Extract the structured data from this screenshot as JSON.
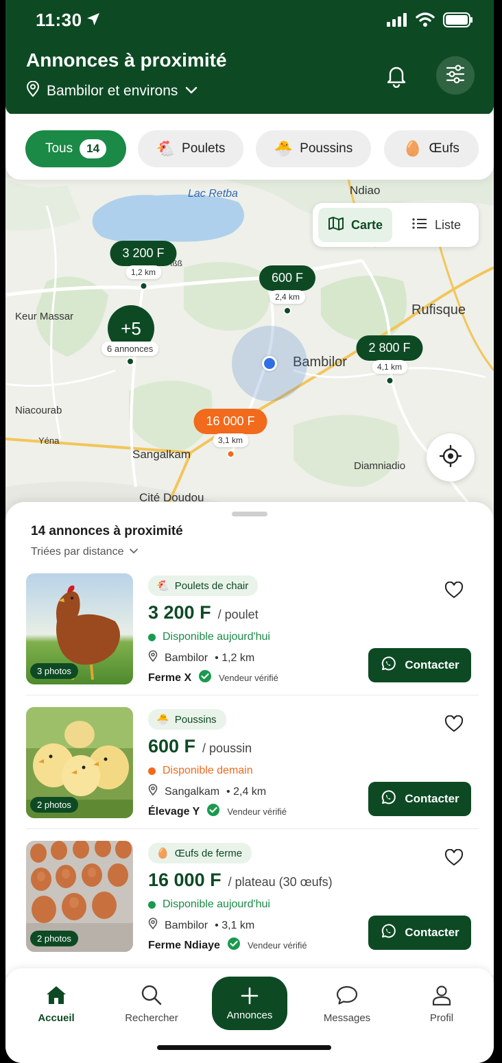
{
  "status_bar": {
    "time": "11:30"
  },
  "header": {
    "title": "Annonces à proximité",
    "location": "Bambilor et environs"
  },
  "filters": [
    {
      "label": "Tous",
      "count": "14",
      "active": true
    },
    {
      "label": "Poulets",
      "icon": "chicken-emoji"
    },
    {
      "label": "Poussins",
      "icon": "chick-emoji"
    },
    {
      "label": "Œufs",
      "icon": "egg-emoji"
    }
  ],
  "map": {
    "toggle": {
      "map_label": "Carte",
      "list_label": "Liste"
    },
    "places": [
      "Lac Retba",
      "Ndiao",
      "Keur Massar",
      "Rufisque",
      "Bambilor",
      "Niacourab",
      "Yéna",
      "Sangalkam",
      "Diamniadio",
      "Cité Doudou",
      "ıßß"
    ],
    "pins": [
      {
        "price": "3 200 F",
        "distance": "1,2 km"
      },
      {
        "price": "600 F",
        "distance": "2,4 km"
      },
      {
        "price": "2 800 F",
        "distance": "4,1 km"
      },
      {
        "price": "16 000 F",
        "distance": "3,1 km",
        "highlight": true
      }
    ],
    "cluster": {
      "count": "+5",
      "label": "6 annonces"
    }
  },
  "list": {
    "title": "14 annonces à proximité",
    "sort": "Triées par distance",
    "items": [
      {
        "photos": "3 photos",
        "category": "Poulets de chair",
        "price": "3 200 F",
        "unit": "/ poulet",
        "availability": "Disponible aujourd'hui",
        "availability_color": "#1a9a4e",
        "place": "Bambilor",
        "distance": "• 1,2 km",
        "seller": "Ferme X",
        "verified": "Vendeur vérifié",
        "contact": "Contacter"
      },
      {
        "photos": "2 photos",
        "category": "Poussins",
        "price": "600 F",
        "unit": "/ poussin",
        "availability": "Disponible demain",
        "availability_color": "#f26a1b",
        "place": "Sangalkam",
        "distance": "• 2,4 km",
        "seller": "Élevage Y",
        "verified": "Vendeur vérifié",
        "contact": "Contacter"
      },
      {
        "photos": "2 photos",
        "category": "Œufs de ferme",
        "price": "16 000 F",
        "unit": "/ plateau (30 œufs)",
        "availability": "Disponible aujourd'hui",
        "availability_color": "#1a9a4e",
        "place": "Bambilor",
        "distance": "• 3,1 km",
        "seller": "Ferme Ndiaye",
        "verified": "Vendeur vérifié",
        "contact": "Contacter"
      }
    ]
  },
  "nav": {
    "home": "Accueil",
    "search": "Rechercher",
    "post": "Annonces",
    "messages": "Messages",
    "profile": "Profil"
  },
  "colors": {
    "brand": "#0d4a24",
    "accent": "#1a8a46",
    "highlight": "#f26a1b",
    "user_location": "#2f6fe6"
  }
}
